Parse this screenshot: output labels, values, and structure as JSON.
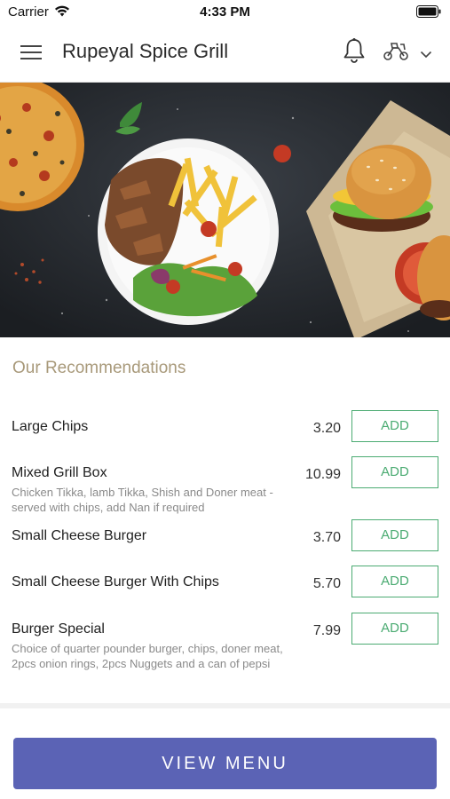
{
  "status_bar": {
    "carrier": "Carrier",
    "time": "4:33 PM",
    "icons": [
      "wifi-icon",
      "battery-icon"
    ]
  },
  "header": {
    "title": "Rupeyal Spice Grill",
    "icons": [
      "hamburger-menu-icon",
      "bell-icon",
      "delivery-scooter-icon",
      "chevron-down-icon"
    ]
  },
  "banner": {
    "image": "food-banner"
  },
  "recommendations": {
    "title": "Our Recommendations",
    "items": [
      {
        "name": "Large Chips",
        "description": "",
        "price": "3.20",
        "button": "ADD"
      },
      {
        "name": "Mixed Grill Box",
        "description": "Chicken Tikka, lamb Tikka, Shish and Doner meat - served with chips, add Nan if required",
        "price": "10.99",
        "button": "ADD"
      },
      {
        "name": "Small Cheese Burger",
        "description": "",
        "price": "3.70",
        "button": "ADD"
      },
      {
        "name": "Small Cheese Burger With Chips",
        "description": "",
        "price": "5.70",
        "button": "ADD"
      },
      {
        "name": "Burger Special",
        "description": "Choice of quarter pounder burger, chips, doner meat, 2pcs onion rings, 2pcs Nuggets and a can of pepsi",
        "price": "7.99",
        "button": "ADD"
      }
    ]
  },
  "footer": {
    "view_menu_label": "VIEW MENU"
  },
  "colors": {
    "accent": "#5b63b5",
    "add_green": "#4bab72",
    "section_title": "#a8997a"
  }
}
